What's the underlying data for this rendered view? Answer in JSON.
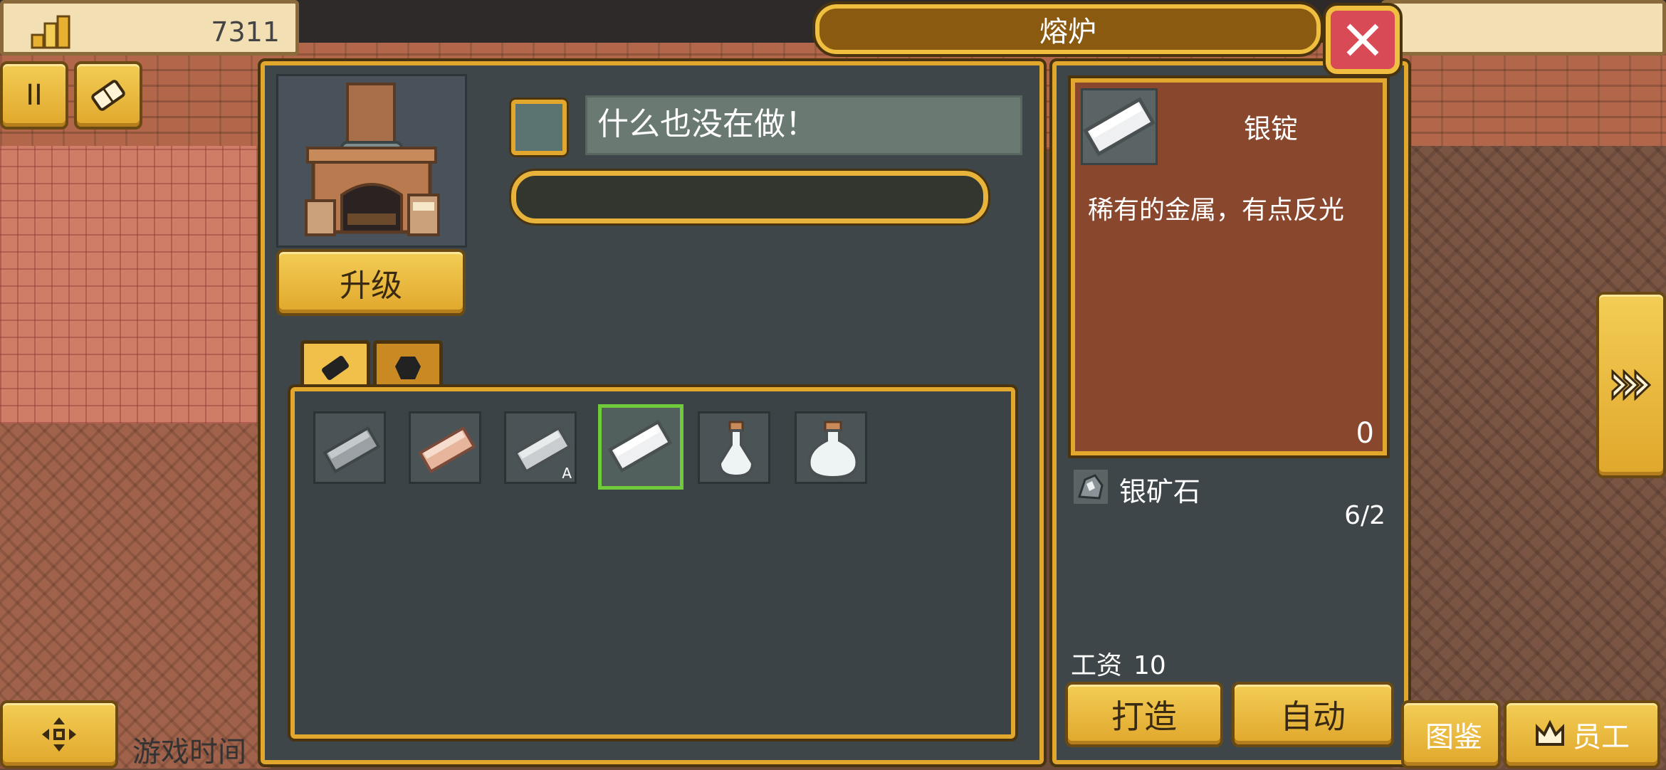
{
  "top_bar": {
    "coins": "7311"
  },
  "window": {
    "title": "熔炉"
  },
  "furnace": {
    "status": "什么也没在做！",
    "progress": 0,
    "upgrade_label": "升级"
  },
  "tabs": [
    {
      "icon": "ingot-tab-icon",
      "active": true
    },
    {
      "icon": "gem-tab-icon",
      "active": false
    }
  ],
  "recipes": [
    {
      "icon": "iron-ingot-icon",
      "badge": ""
    },
    {
      "icon": "copper-ingot-icon",
      "badge": ""
    },
    {
      "icon": "silver-ingot-a-icon",
      "badge": "A"
    },
    {
      "icon": "silver-ingot-icon",
      "badge": "",
      "selected": true
    },
    {
      "icon": "small-potion-flask-icon",
      "badge": ""
    },
    {
      "icon": "large-potion-flask-icon",
      "badge": ""
    }
  ],
  "selected_item": {
    "name": "银锭",
    "description": "稀有的金属，有点反光",
    "owned": "0",
    "requirement": {
      "icon": "silver-ore-icon",
      "name": "银矿石",
      "count": "6/2"
    },
    "wage_label": "工资",
    "wage_value": "10",
    "craft_label": "打造",
    "auto_label": "自动"
  },
  "hud": {
    "pause_label": "II",
    "game_time_label": "游戏时间",
    "atlas_label": "图鉴",
    "staff_label": "员工"
  },
  "colors": {
    "gold": "#e1a82d",
    "panel": "#3e4649",
    "card": "#89472e",
    "close": "#d84a55",
    "selected": "#6fcb3a"
  }
}
